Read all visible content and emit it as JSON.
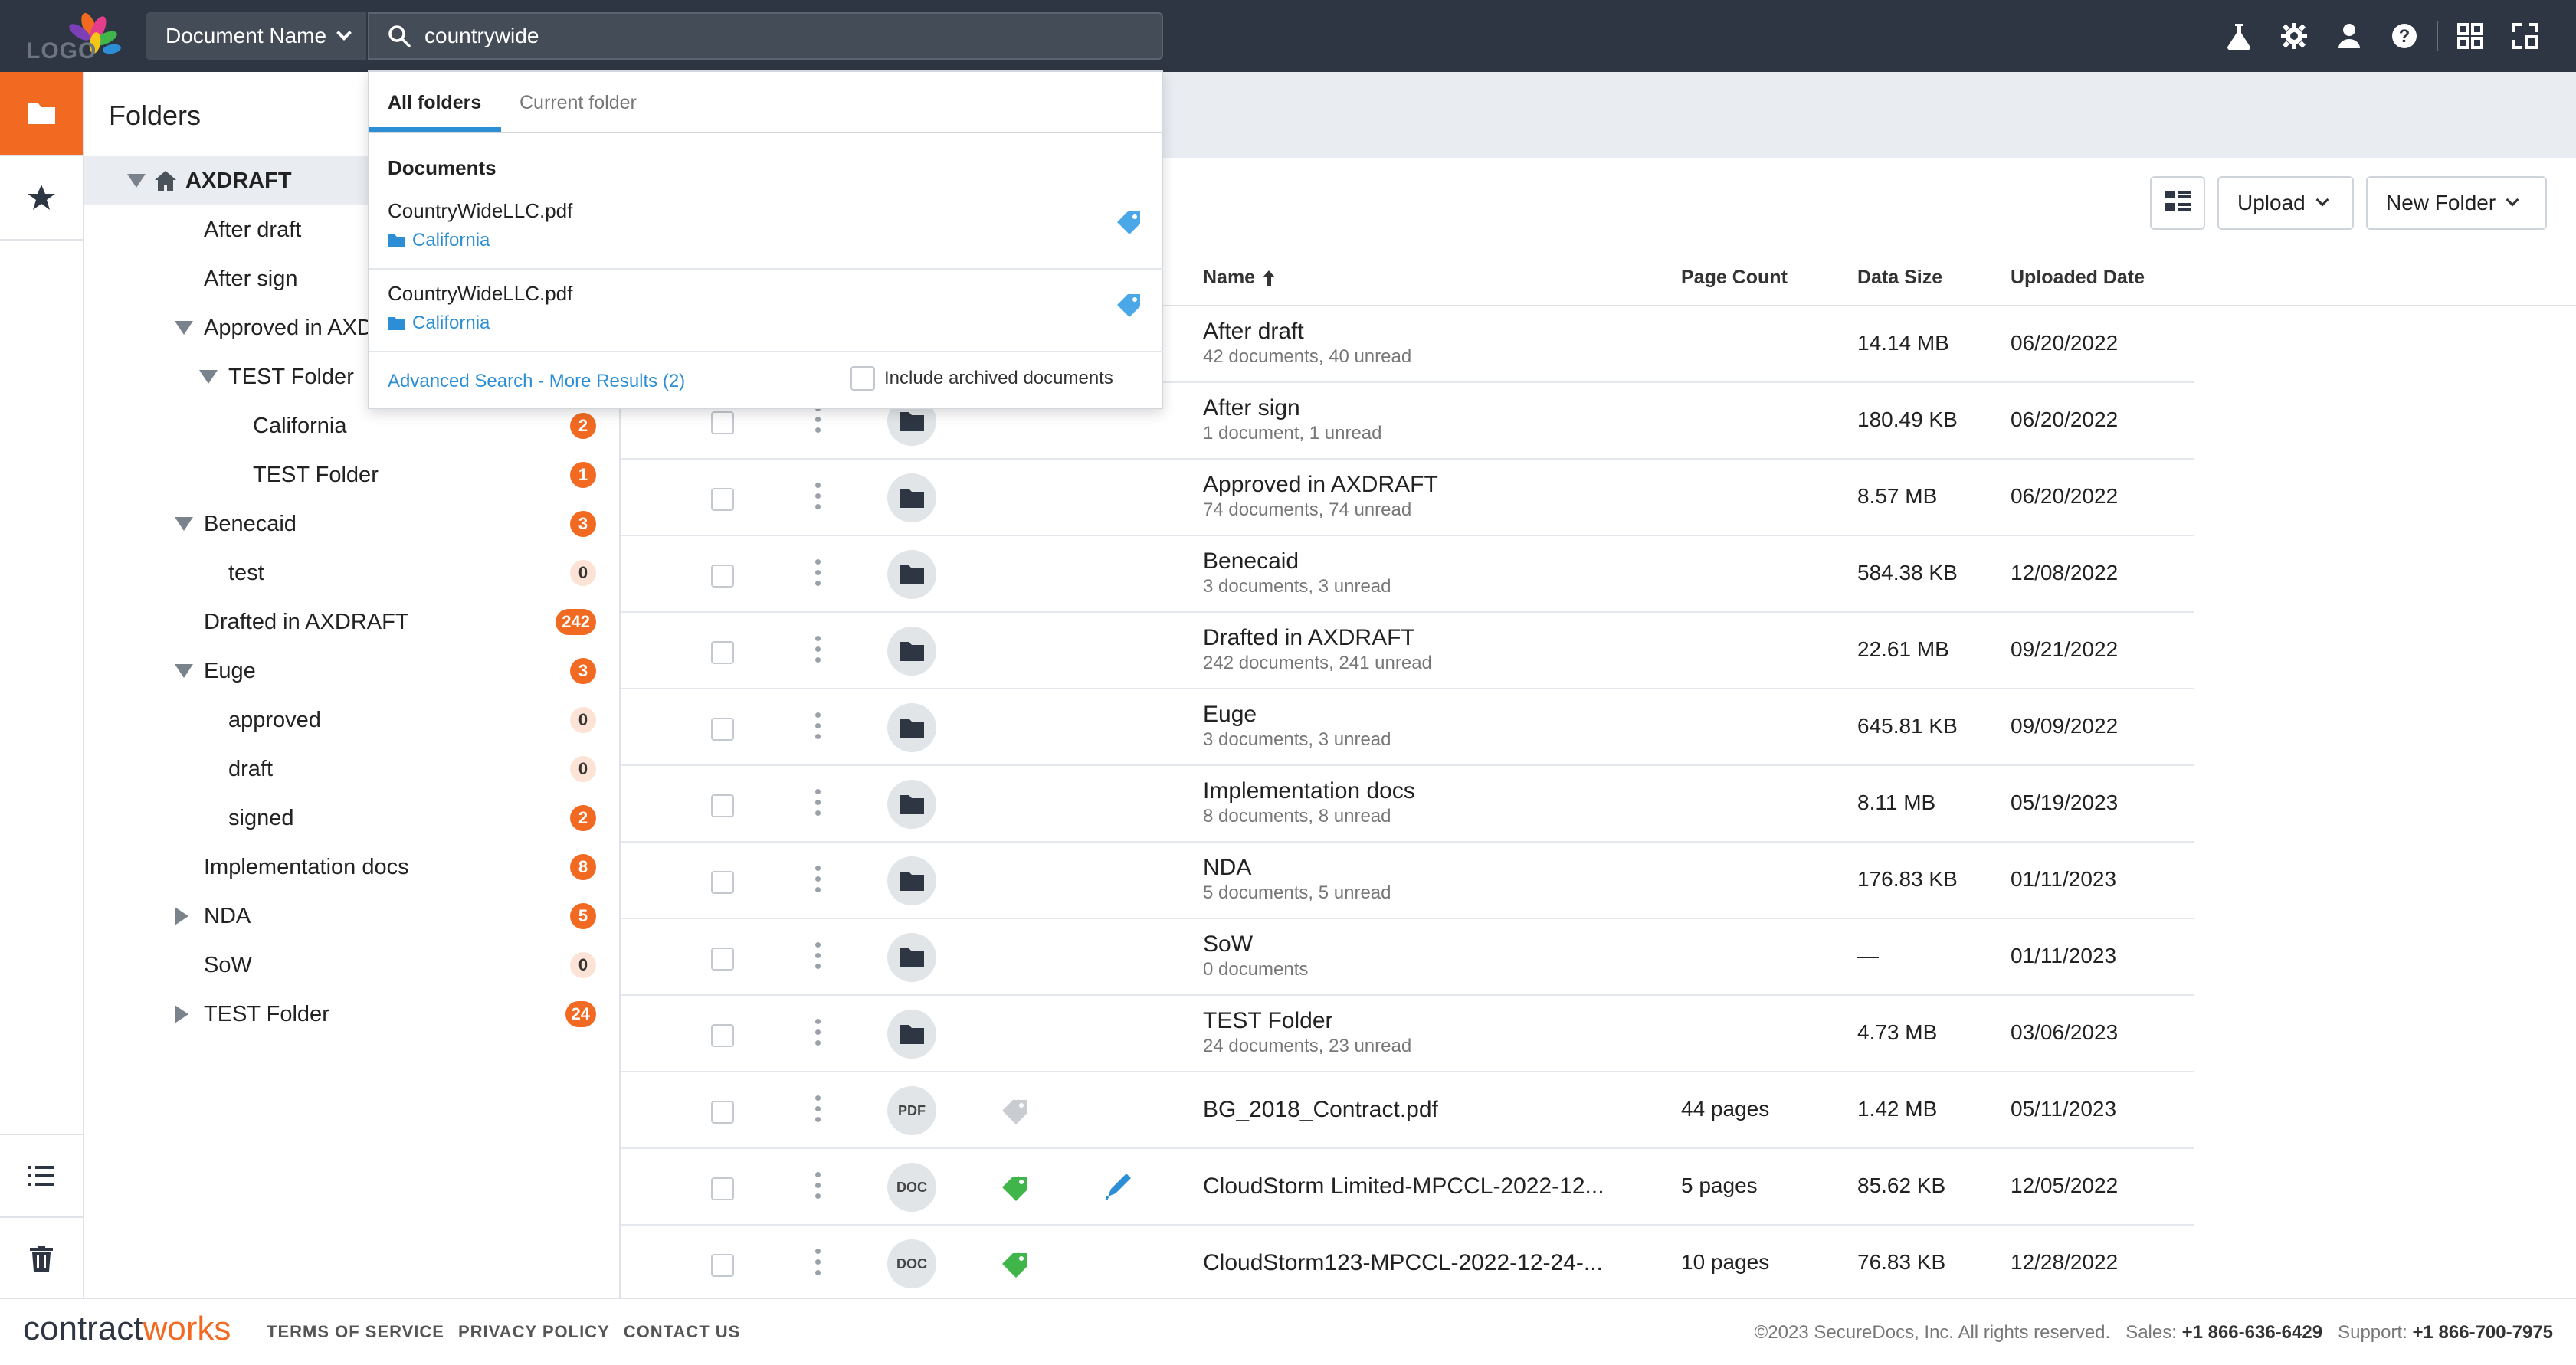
{
  "topbar": {
    "logo_text": "LOGO",
    "search_scope": "Document Name",
    "search_value": "countrywide",
    "icons": [
      "flask-icon",
      "gear-icon",
      "user-icon",
      "help-icon",
      "apps-grid-icon",
      "fullscreen-icon"
    ]
  },
  "folders_panel": {
    "title": "Folders",
    "tree": [
      {
        "label": "AXDRAFT",
        "level": 0,
        "toggle": "down",
        "home": true,
        "selected": true,
        "badge": null
      },
      {
        "label": "After draft",
        "level": 1,
        "toggle": null,
        "badge": null
      },
      {
        "label": "After sign",
        "level": 1,
        "toggle": null,
        "badge": null
      },
      {
        "label": "Approved in AXDRAFT",
        "level": 1,
        "toggle": "down",
        "badge": null
      },
      {
        "label": "TEST Folder",
        "level": 2,
        "toggle": "down",
        "badge": null
      },
      {
        "label": "California",
        "level": 3,
        "toggle": null,
        "badge": "2"
      },
      {
        "label": "TEST Folder",
        "level": 3,
        "toggle": null,
        "badge": "1"
      },
      {
        "label": "Benecaid",
        "level": 1,
        "toggle": "down",
        "badge": "3"
      },
      {
        "label": "test",
        "level": 2,
        "toggle": null,
        "badge": "0"
      },
      {
        "label": "Drafted in AXDRAFT",
        "level": 1,
        "toggle": null,
        "badge": "242"
      },
      {
        "label": "Euge",
        "level": 1,
        "toggle": "down",
        "badge": "3"
      },
      {
        "label": "approved",
        "level": 2,
        "toggle": null,
        "badge": "0"
      },
      {
        "label": "draft",
        "level": 2,
        "toggle": null,
        "badge": "0"
      },
      {
        "label": "signed",
        "level": 2,
        "toggle": null,
        "badge": "2"
      },
      {
        "label": "Implementation docs",
        "level": 1,
        "toggle": null,
        "badge": "8"
      },
      {
        "label": "NDA",
        "level": 1,
        "toggle": "right",
        "badge": "5"
      },
      {
        "label": "SoW",
        "level": 1,
        "toggle": null,
        "badge": "0"
      },
      {
        "label": "TEST Folder",
        "level": 1,
        "toggle": "right",
        "badge": "24"
      }
    ]
  },
  "toolbar": {
    "upload_label": "Upload",
    "new_folder_label": "New Folder"
  },
  "table": {
    "columns": {
      "name": "Name",
      "page_count": "Page Count",
      "data_size": "Data Size",
      "uploaded_date": "Uploaded Date"
    },
    "rows": [
      {
        "kind": "folder",
        "name": "After draft",
        "sub": "42 documents, 40 unread",
        "pages": "",
        "size": "14.14 MB",
        "date": "06/20/2022"
      },
      {
        "kind": "folder",
        "name": "After sign",
        "sub": "1 document, 1 unread",
        "pages": "",
        "size": "180.49 KB",
        "date": "06/20/2022"
      },
      {
        "kind": "folder",
        "name": "Approved in AXDRAFT",
        "sub": "74 documents, 74 unread",
        "pages": "",
        "size": "8.57 MB",
        "date": "06/20/2022"
      },
      {
        "kind": "folder",
        "name": "Benecaid",
        "sub": "3 documents, 3 unread",
        "pages": "",
        "size": "584.38 KB",
        "date": "12/08/2022"
      },
      {
        "kind": "folder",
        "name": "Drafted in AXDRAFT",
        "sub": "242 documents, 241 unread",
        "pages": "",
        "size": "22.61 MB",
        "date": "09/21/2022"
      },
      {
        "kind": "folder",
        "name": "Euge",
        "sub": "3 documents, 3 unread",
        "pages": "",
        "size": "645.81 KB",
        "date": "09/09/2022"
      },
      {
        "kind": "folder",
        "name": "Implementation docs",
        "sub": "8 documents, 8 unread",
        "pages": "",
        "size": "8.11 MB",
        "date": "05/19/2023"
      },
      {
        "kind": "folder",
        "name": "NDA",
        "sub": "5 documents, 5 unread",
        "pages": "",
        "size": "176.83 KB",
        "date": "01/11/2023"
      },
      {
        "kind": "folder",
        "name": "SoW",
        "sub": "0 documents",
        "pages": "",
        "size": "—",
        "date": "01/11/2023"
      },
      {
        "kind": "folder",
        "name": "TEST Folder",
        "sub": "24 documents, 23 unread",
        "pages": "",
        "size": "4.73 MB",
        "date": "03/06/2023"
      },
      {
        "kind": "file",
        "type": "PDF",
        "tag": "gray",
        "signed": false,
        "name": "BG_2018_Contract.pdf",
        "sub": "",
        "pages": "44 pages",
        "size": "1.42 MB",
        "date": "05/11/2023"
      },
      {
        "kind": "file",
        "type": "DOC",
        "tag": "green",
        "signed": true,
        "name": "CloudStorm Limited-MPCCL-2022-12...",
        "sub": "",
        "pages": "5 pages",
        "size": "85.62 KB",
        "date": "12/05/2022"
      },
      {
        "kind": "file",
        "type": "DOC",
        "tag": "green",
        "signed": false,
        "name": "CloudStorm123-MPCCL-2022-12-24-...",
        "sub": "",
        "pages": "10 pages",
        "size": "76.83 KB",
        "date": "12/28/2022"
      }
    ]
  },
  "search_dropdown": {
    "tabs": [
      "All folders",
      "Current folder"
    ],
    "section_title": "Documents",
    "results": [
      {
        "name": "CountryWideLLC.pdf",
        "folder": "California"
      },
      {
        "name": "CountryWideLLC.pdf",
        "folder": "California"
      }
    ],
    "advanced_link": "Advanced Search - More Results (2)",
    "include_archived": "Include archived documents"
  },
  "footer": {
    "brand_prefix": "contract",
    "brand_suffix": "works",
    "links": [
      "TERMS OF SERVICE",
      "PRIVACY POLICY",
      "CONTACT US"
    ],
    "copyright": "©2023 SecureDocs, Inc. All rights reserved.",
    "sales_label": "Sales:",
    "sales_phone": "+1 866-636-6429",
    "support_label": "Support:",
    "support_phone": "+1 866-700-7975"
  },
  "colors": {
    "accent": "#f26a21",
    "topbar": "#2d3642",
    "link": "#2c8fd6",
    "tag_green": "#3fb54a",
    "tag_blue": "#4aa8e8"
  }
}
